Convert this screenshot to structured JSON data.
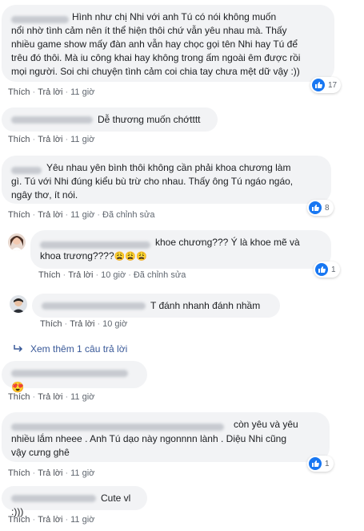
{
  "actions": {
    "like": "Thích",
    "reply": "Trả lời",
    "sep": "·",
    "edited": "Đã chỉnh sửa"
  },
  "comments": [
    {
      "lines": [
        "Hình như chị Nhi với anh Tú có nói không muốn",
        "nổi nhờ tình cảm nên ít thể hiện thôi chứ vẫn yêu nhau mà. Thấy",
        "nhiều game show mấy đàn anh vẫn hay chọc gọi tên Nhi hay Tú để",
        "trêu đó thôi. Mà iu công khai hay không trong ấm ngoài êm được rồi",
        "mọi người. Soi chi chuyện tình cảm coi chia tay chưa mệt dữ vậy :))"
      ],
      "time": "11 giờ",
      "reactions": "17"
    },
    {
      "lines": [
        "Dễ thương muốn chớtttt"
      ],
      "time": "11 giờ"
    },
    {
      "lines": [
        "Yêu nhau yên bình thôi không cần phải khoa chương làm",
        "gì. Tú với Nhi đúng kiểu bù trừ cho nhau. Thấy ông Tú ngáo ngáo,",
        "ngây thơ, ít nói."
      ],
      "time": "11 giờ",
      "reactions": "8"
    }
  ],
  "replies": [
    {
      "lines": [
        "khoe chương??? Ý là khoe mẽ và",
        "khoa trương????"
      ],
      "emojis": "😩😩😩",
      "time": "10 giờ",
      "reactions": "1"
    },
    {
      "lines": [
        "T đánh nhanh đánh nhầm"
      ],
      "time": "10 giờ"
    }
  ],
  "more_replies": "Xem thêm 1 câu trả lời",
  "comments2": [
    {
      "emoji": "😍",
      "time": "11 giờ"
    },
    {
      "lines": [
        "còn yêu và yêu",
        "nhiều lắm nheee . Anh Tú dạo này ngonnnn lành . Diệu Nhi cũng",
        "vậy cưng ghê"
      ],
      "time": "11 giờ",
      "reactions": "1"
    },
    {
      "lines": [
        "Cute vl :)))"
      ],
      "time": "11 giờ"
    }
  ],
  "colors": {
    "bubble": "#f2f3f5",
    "like_blue": "#1877f2",
    "link": "#385898",
    "meta": "#606770"
  }
}
